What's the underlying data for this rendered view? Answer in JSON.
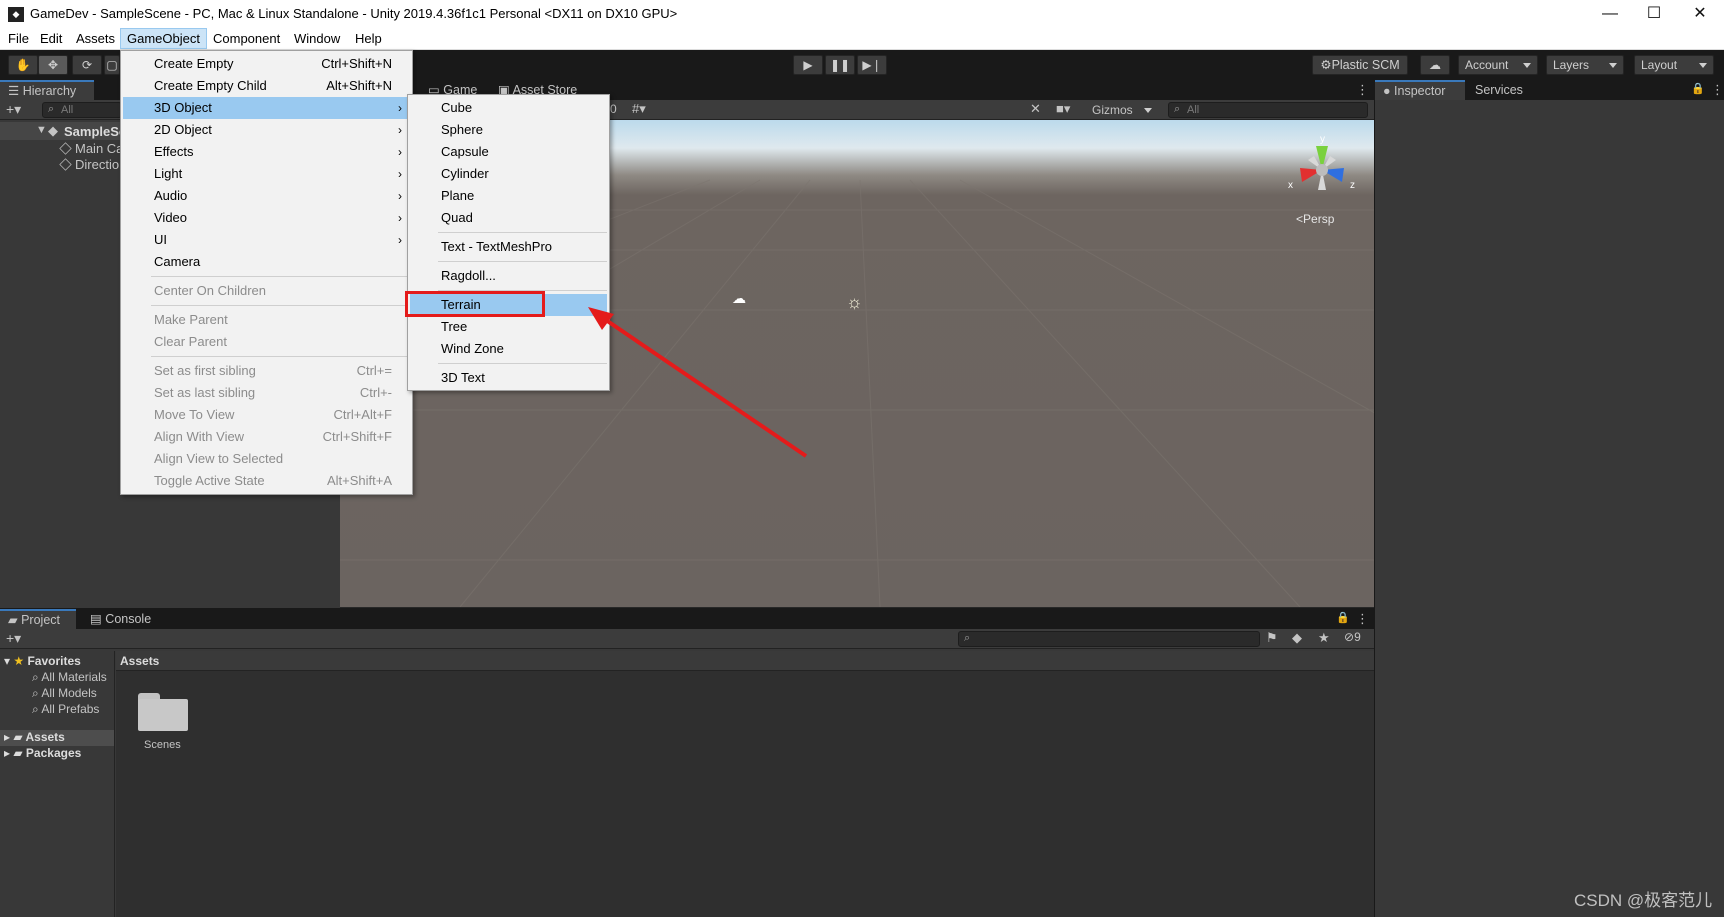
{
  "window": {
    "title": "GameDev - SampleScene - PC, Mac & Linux Standalone - Unity 2019.4.36f1c1 Personal <DX11 on DX10 GPU>",
    "app_icon": "unity-icon"
  },
  "menubar": [
    "File",
    "Edit",
    "Assets",
    "GameObject",
    "Component",
    "Window",
    "Help"
  ],
  "toolbar": {
    "plastic": "Plastic SCM",
    "account": "Account",
    "layers": "Layers",
    "layout": "Layout"
  },
  "hierarchy": {
    "tab": "Hierarchy",
    "search": "All",
    "scene": "SampleSc",
    "items": [
      "Main Ca",
      "Directio"
    ]
  },
  "scene": {
    "tabs": [
      "Game",
      "Asset Store"
    ],
    "gizmos": "Gizmos",
    "search": "All",
    "persp": "Persp",
    "count": "0",
    "axes": {
      "x": "x",
      "y": "y",
      "z": "z"
    }
  },
  "inspector": {
    "tabs": [
      "Inspector",
      "Services"
    ]
  },
  "project": {
    "tabs": [
      "Project",
      "Console"
    ],
    "badge": "9",
    "favorites": "Favorites",
    "fav_items": [
      "All Materials",
      "All Models",
      "All Prefabs"
    ],
    "roots": [
      "Assets",
      "Packages"
    ],
    "breadcrumb": "Assets",
    "folder": "Scenes"
  },
  "gameobject_menu": [
    {
      "label": "Create Empty",
      "shortcut": "Ctrl+Shift+N"
    },
    {
      "label": "Create Empty Child",
      "shortcut": "Alt+Shift+N"
    },
    {
      "label": "3D Object",
      "sub": true
    },
    {
      "label": "2D Object",
      "sub": true
    },
    {
      "label": "Effects",
      "sub": true
    },
    {
      "label": "Light",
      "sub": true
    },
    {
      "label": "Audio",
      "sub": true
    },
    {
      "label": "Video",
      "sub": true
    },
    {
      "label": "UI",
      "sub": true
    },
    {
      "label": "Camera"
    },
    {
      "label": "Center On Children"
    },
    {
      "label": "Make Parent"
    },
    {
      "label": "Clear Parent"
    },
    {
      "label": "Set as first sibling",
      "shortcut": "Ctrl+="
    },
    {
      "label": "Set as last sibling",
      "shortcut": "Ctrl+-"
    },
    {
      "label": "Move To View",
      "shortcut": "Ctrl+Alt+F"
    },
    {
      "label": "Align With View",
      "shortcut": "Ctrl+Shift+F"
    },
    {
      "label": "Align View to Selected"
    },
    {
      "label": "Toggle Active State",
      "shortcut": "Alt+Shift+A"
    }
  ],
  "object3d_menu": [
    "Cube",
    "Sphere",
    "Capsule",
    "Cylinder",
    "Plane",
    "Quad",
    "Text - TextMeshPro",
    "Ragdoll...",
    "Terrain",
    "Tree",
    "Wind Zone",
    "3D Text"
  ],
  "watermark": "CSDN @极客范儿",
  "colors": {
    "highlight": "#99c9f0",
    "annotation": "#e41b1b",
    "accent": "#3a79bb"
  }
}
